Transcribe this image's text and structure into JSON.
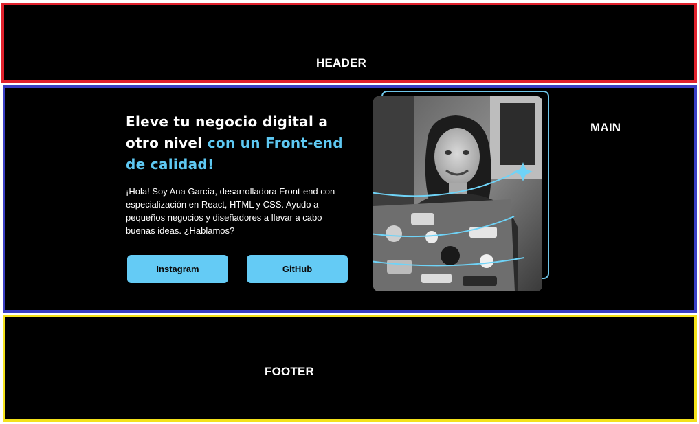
{
  "sections": {
    "header_label": "HEADER",
    "main_label": "MAIN",
    "footer_label": "FOOTER"
  },
  "colors": {
    "header_border": "#e1222d",
    "main_border": "#3a3fc4",
    "footer_border": "#f3e11b",
    "accent": "#5ec8f2",
    "button_bg": "#64cbf5"
  },
  "hero": {
    "title_plain": "Eleve tu negocio digital a otro nivel ",
    "title_accent": "con un Front-end de calidad!",
    "description": "¡Hola! Soy Ana García, desarrolladora Front-end con especialización en React, HTML y CSS. Ayudo a pequeños negocios y diseñadores a llevar a cabo buenas ideas. ¿Hablamos?",
    "buttons": {
      "instagram": "Instagram",
      "github": "GitHub"
    }
  },
  "image": {
    "subject": "profile-photo-woman-with-laptop",
    "sparkle_icon": "sparkle-star-icon"
  }
}
